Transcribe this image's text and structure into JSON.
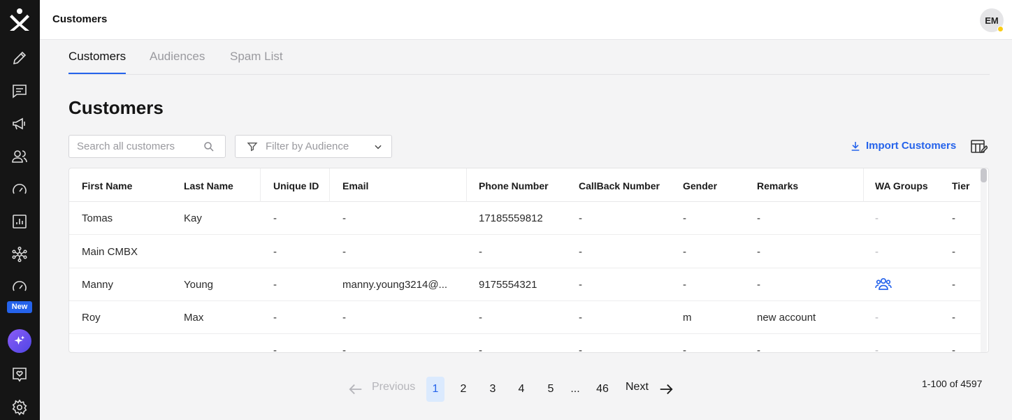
{
  "header": {
    "title": "Customers",
    "avatar_initials": "EM"
  },
  "sidebar": {
    "new_badge": "New",
    "items": [
      "logo-icon",
      "edit-icon",
      "chat-icon",
      "megaphone-icon",
      "users-icon",
      "gauge-icon",
      "report-icon",
      "network-icon",
      "gauge-new-icon",
      "ai-sparkle-icon",
      "heart-message-icon",
      "gear-icon"
    ]
  },
  "tabs": [
    {
      "label": "Customers",
      "active": true
    },
    {
      "label": "Audiences",
      "active": false
    },
    {
      "label": "Spam List",
      "active": false
    }
  ],
  "page_title": "Customers",
  "toolbar": {
    "search_placeholder": "Search all customers",
    "filter_placeholder": "Filter by Audience",
    "import_label": "Import Customers"
  },
  "table": {
    "columns": [
      "First Name",
      "Last Name",
      "Unique ID",
      "Email",
      "Phone Number",
      "CallBack Number",
      "Gender",
      "Remarks",
      "WA Groups",
      "Tier"
    ],
    "rows": [
      [
        "Tomas",
        "Kay",
        "-",
        "-",
        "17185559812",
        "-",
        "-",
        "-",
        "-",
        "-"
      ],
      [
        "Main CMBX",
        "",
        "-",
        "-",
        "-",
        "-",
        "-",
        "-",
        "-",
        "-"
      ],
      [
        "Manny",
        "Young",
        "-",
        "manny.young3214@...",
        "9175554321",
        "-",
        "-",
        "-",
        "",
        "-"
      ],
      [
        "Roy",
        "Max",
        "-",
        "-",
        "-",
        "-",
        "m",
        "new account",
        "-",
        "-"
      ],
      [
        "",
        "",
        "-",
        "-",
        "-",
        "-",
        "-",
        "-",
        "-",
        "-"
      ]
    ]
  },
  "pagination": {
    "previous": "Previous",
    "next": "Next",
    "pages": [
      "1",
      "2",
      "3",
      "4",
      "5",
      "...",
      "46"
    ],
    "current": "1",
    "summary": "1-100 of 4597"
  },
  "colors": {
    "accent": "#2563eb",
    "sidebar": "#151515",
    "badge_new": "#2563eb",
    "presence_dot": "#facc15"
  }
}
